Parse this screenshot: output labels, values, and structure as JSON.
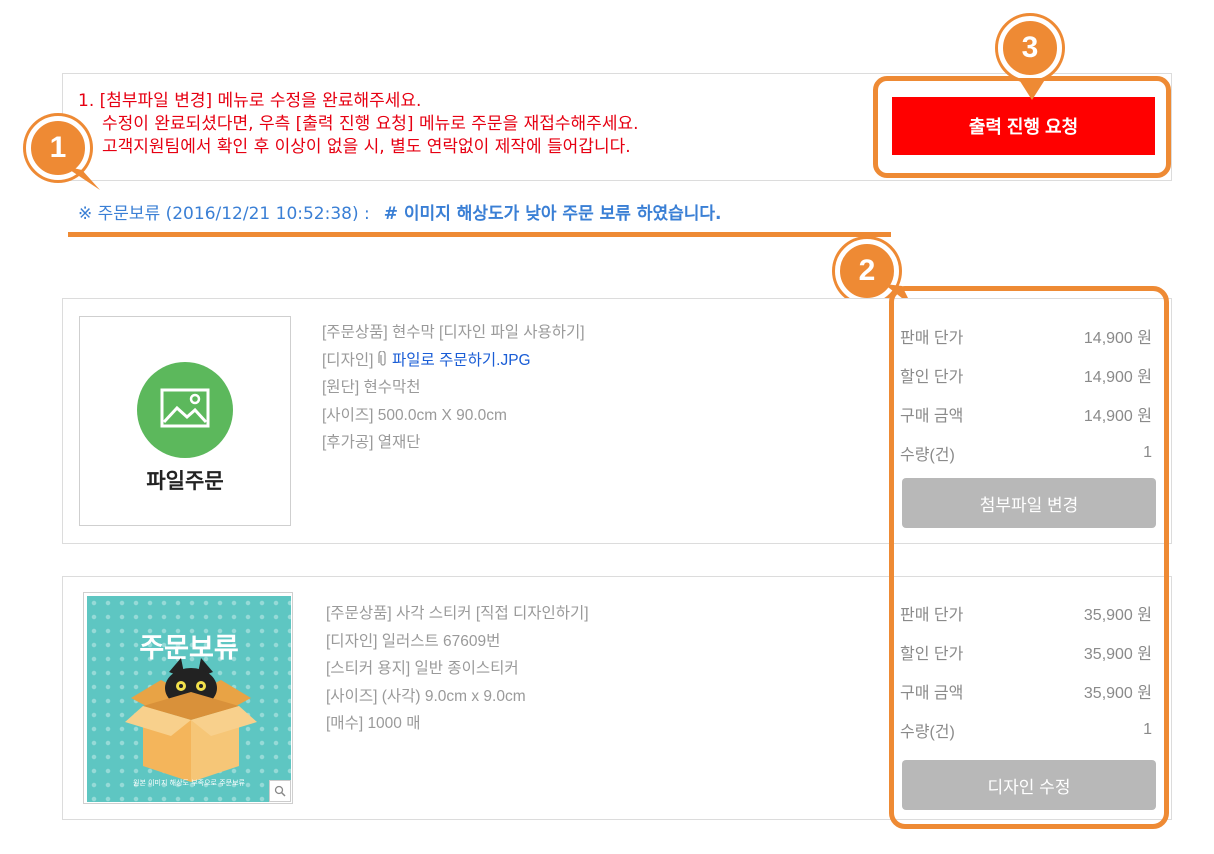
{
  "notice": {
    "line1": "1. [첨부파일 변경] 메뉴로 수정을 완료해주세요.",
    "line2": "수정이 완료되셨다면, 우측 [출력 진행 요청] 메뉴로 주문을 재접수해주세요.",
    "line3": "고객지원팀에서 확인 후 이상이 없을 시, 별도 연락없이 제작에 들어갑니다."
  },
  "cta": {
    "label": "출력 진행 요청"
  },
  "hold": {
    "prefix": "※ 주문보류 (2016/12/21 10:52:38) :",
    "message": "# 이미지 해상도가 낮아 주문 보류 하였습니다."
  },
  "markers": {
    "m1": "1",
    "m2": "2",
    "m3": "3"
  },
  "orders": [
    {
      "thumb_label": "파일주문",
      "product": "[주문상품] 현수막 [디자인 파일 사용하기]",
      "design_prefix": "[디자인]",
      "design_link": "파일로 주문하기.JPG",
      "line3": "[원단] 현수막천",
      "line4": "[사이즈] 500.0cm X 90.0cm",
      "line5": "[후가공] 열재단",
      "prices": [
        {
          "label": "판매 단가",
          "value": "14,900 원"
        },
        {
          "label": "할인 단가",
          "value": "14,900 원"
        },
        {
          "label": "구매 금액",
          "value": "14,900 원"
        },
        {
          "label": "수량(건)",
          "value": "1"
        }
      ],
      "button": "첨부파일 변경"
    },
    {
      "thumb_title": "주문보류",
      "thumb_sub": "원본 이미지 해상도 부족으로 주문보류",
      "product": "[주문상품] 사각 스티커 [직접 디자인하기]",
      "line2": "[디자인] 일러스트 67609번",
      "line3": "[스티커 용지] 일반 종이스티커",
      "line4": "[사이즈] (사각) 9.0cm x 9.0cm",
      "line5": "[매수] 1000 매",
      "prices": [
        {
          "label": "판매 단가",
          "value": "35,900 원"
        },
        {
          "label": "할인 단가",
          "value": "35,900 원"
        },
        {
          "label": "구매 금액",
          "value": "35,900 원"
        },
        {
          "label": "수량(건)",
          "value": "1"
        }
      ],
      "button": "디자인 수정"
    }
  ],
  "colors": {
    "accent": "#ee8a34",
    "alert": "#e60012",
    "cta": "#ff0000",
    "link": "#3a7fd5",
    "button_gray": "#b8b8b8",
    "thumb_icon": "#5cb85c"
  },
  "icons": [
    "image-icon",
    "paperclip-icon",
    "zoom-icon",
    "cat-in-box-illustration"
  ]
}
